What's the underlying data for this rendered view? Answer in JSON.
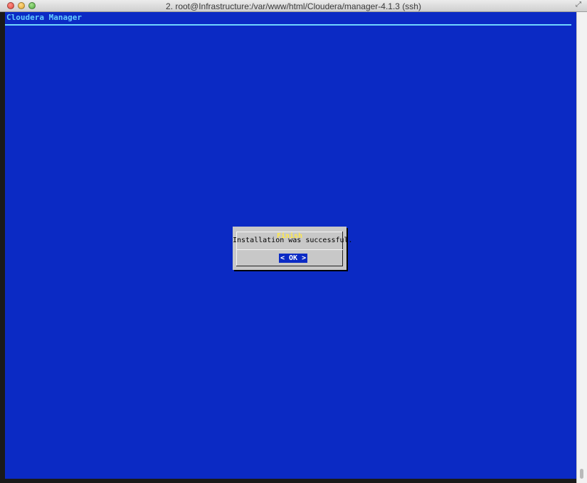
{
  "window": {
    "title": "2. root@Infrastructure:/var/www/html/Cloudera/manager-4.1.3 (ssh)",
    "fullscreen_glyph": "⤢"
  },
  "terminal": {
    "header": "Cloudera Manager",
    "background_color": "#0b2ac4",
    "header_color": "#66ccff"
  },
  "dialog": {
    "title": "Finish",
    "message": "Installation was successful.",
    "ok_label": "< OK >",
    "title_color": "#ffe94a"
  }
}
